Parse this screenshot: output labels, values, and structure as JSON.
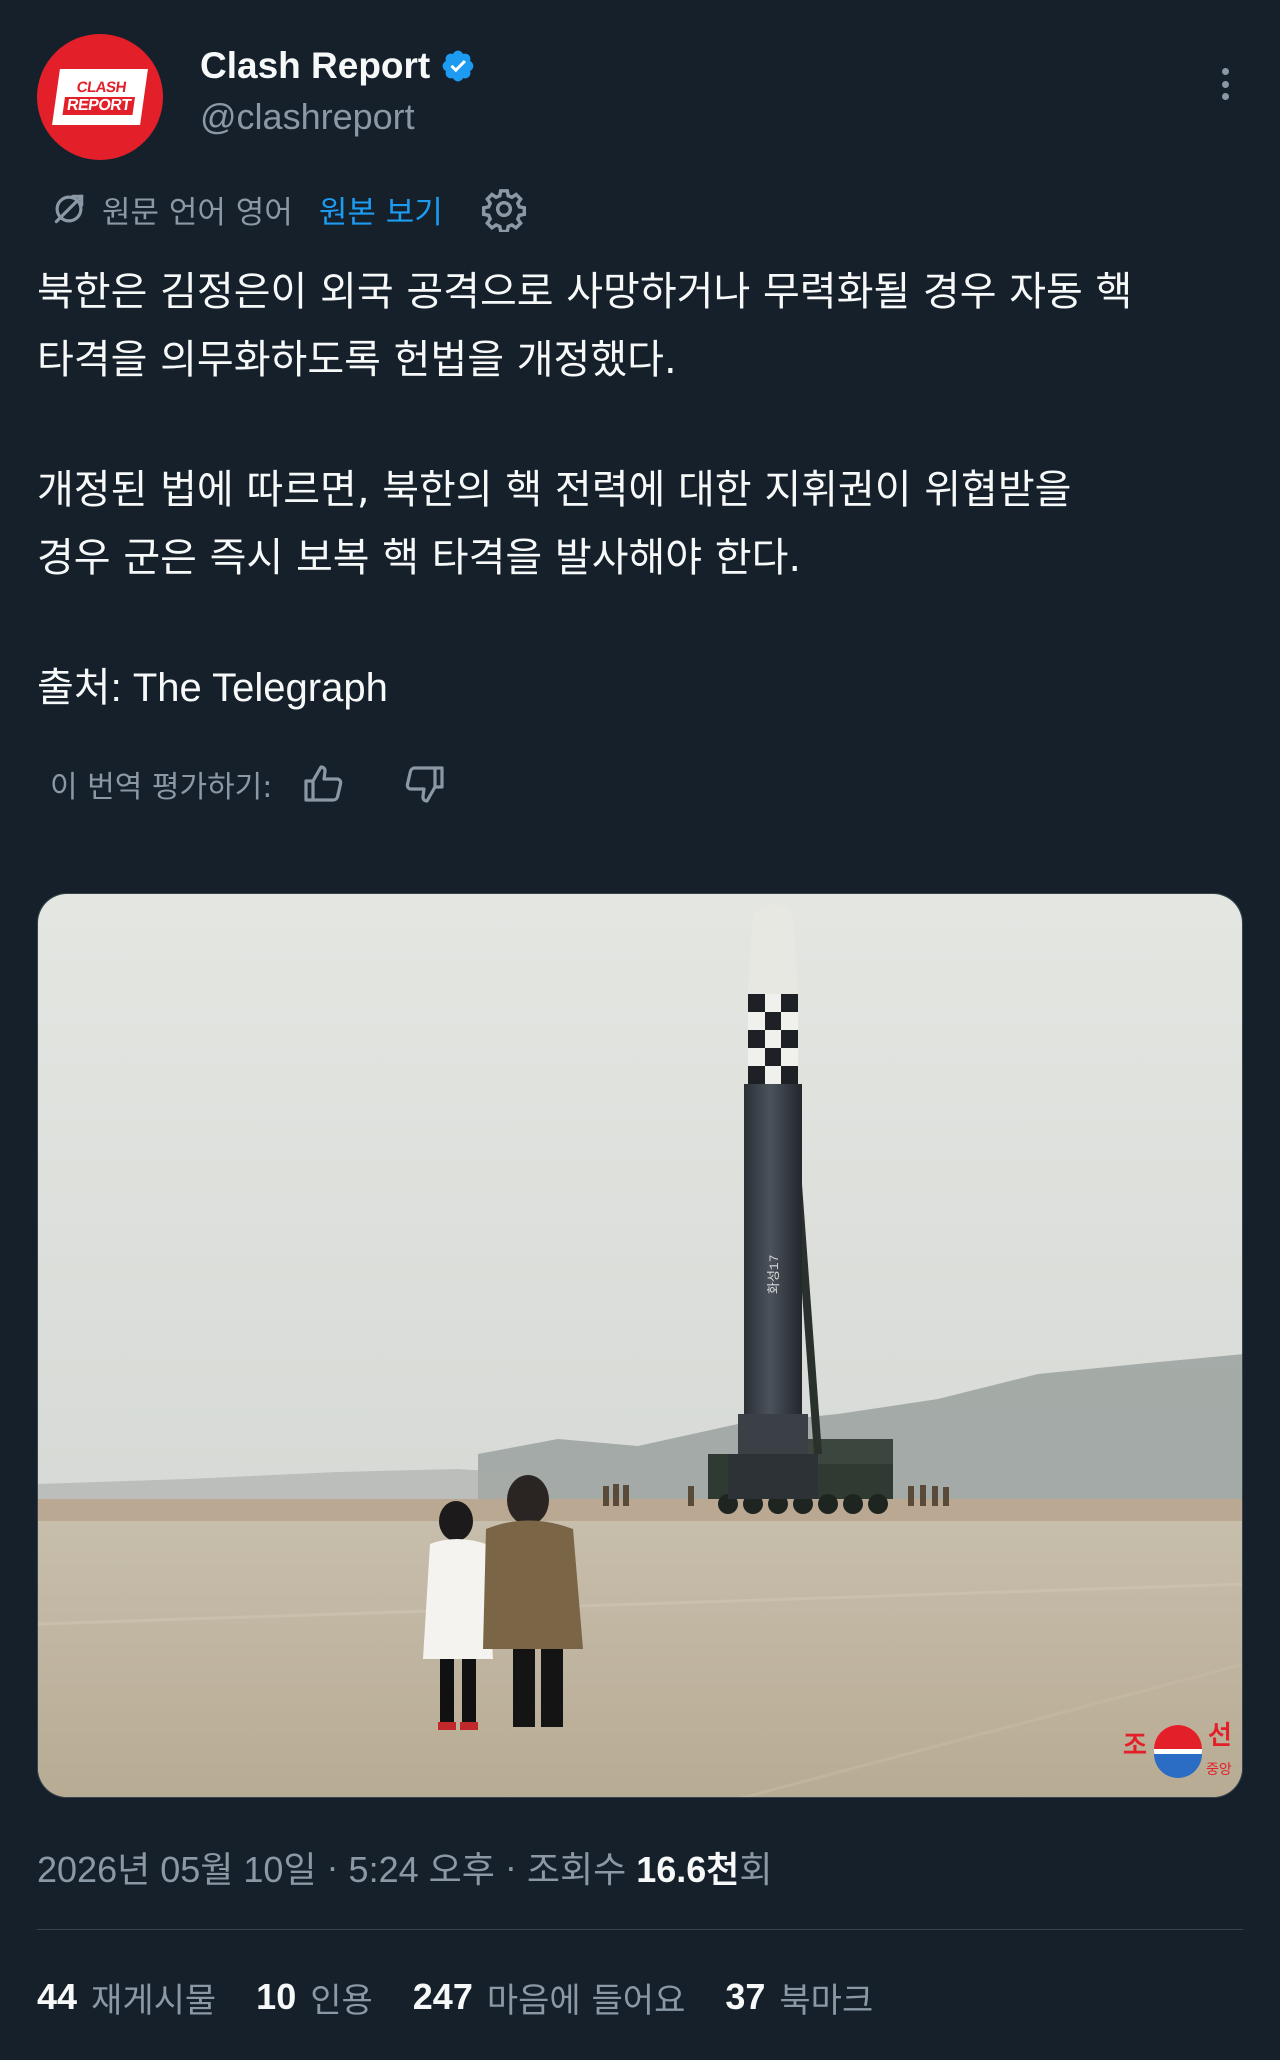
{
  "author": {
    "display_name": "Clash Report",
    "handle": "@clashreport",
    "avatar_logo_line1": "CLASH",
    "avatar_logo_line2": "REPORT",
    "verified": true
  },
  "translation": {
    "original_language": "원문 언어 영어",
    "view_original": "원본 보기",
    "rate_label": "이 번역 평가하기:"
  },
  "tweet": {
    "paragraph1_line1": "북한은 김정은이 외국 공격으로 사망하거나 무력화될 경우 자동 핵",
    "paragraph1_line2": "타격을 의무화하도록 헌법을 개정했다.",
    "paragraph2_line1": "개정된 법에 따르면, 북한의 핵 전력에 대한 지휘권이 위협받을",
    "paragraph2_line2": "경우 군은 즉시 보복 핵 타격을 발사해야 한다.",
    "source": "출처: The Telegraph"
  },
  "media": {
    "missile_serial": "화성17",
    "watermark_left": "조",
    "watermark_right": "선",
    "watermark_sub": "중앙"
  },
  "meta": {
    "date": "2026년 05월 10일",
    "separator": " · ",
    "time": "5:24 오후",
    "views_label": "조회수 ",
    "views_count": "16.6천",
    "views_suffix": "회"
  },
  "stats": [
    {
      "count": "44",
      "label": "재게시물"
    },
    {
      "count": "10",
      "label": "인용"
    },
    {
      "count": "247",
      "label": "마음에 들어요"
    },
    {
      "count": "37",
      "label": "북마크"
    }
  ],
  "colors": {
    "background": "#15202b",
    "accent": "#1d9bf0",
    "muted": "#8b98a5",
    "avatar": "#e3202a"
  }
}
